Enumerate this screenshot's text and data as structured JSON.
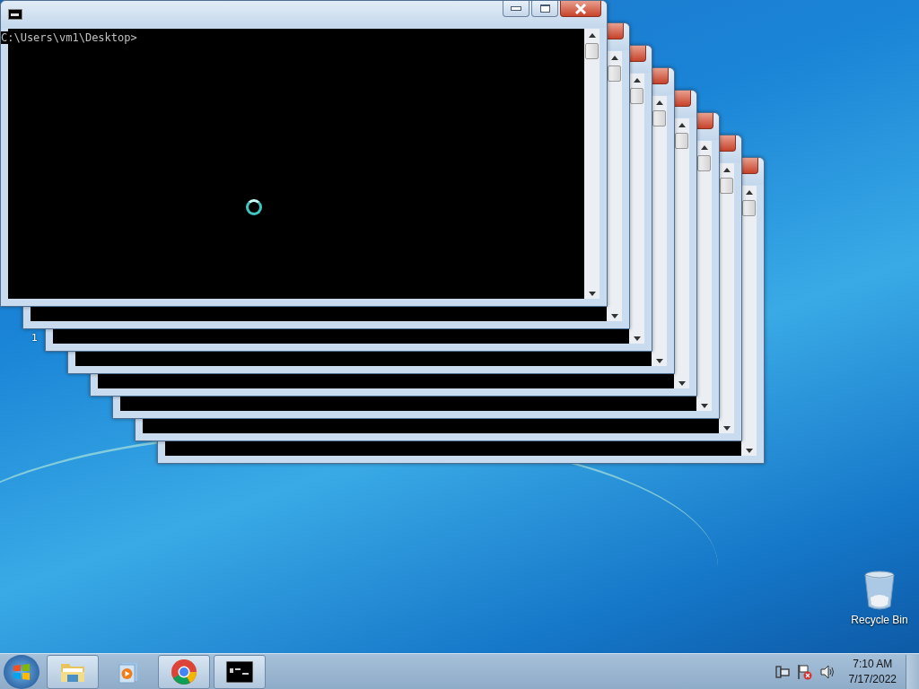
{
  "windows": [
    {
      "kind": "console",
      "prompt": "C:\\Users\\vm1\\Desktop>"
    },
    {
      "kind": "console"
    },
    {
      "kind": "console"
    },
    {
      "kind": "console"
    },
    {
      "kind": "console"
    },
    {
      "kind": "console"
    },
    {
      "kind": "console"
    },
    {
      "kind": "console"
    }
  ],
  "desktop": {
    "stray_label": "1",
    "icons": [
      {
        "kind": "recycle-bin",
        "label": "Recycle Bin"
      }
    ]
  },
  "taskbar": {
    "items": [
      {
        "kind": "folder",
        "running": true
      },
      {
        "kind": "media",
        "running": false
      },
      {
        "kind": "browser",
        "running": true
      },
      {
        "kind": "console",
        "running": true
      }
    ],
    "clock": {
      "time": "7:10 AM",
      "date": "7/17/2022"
    }
  }
}
